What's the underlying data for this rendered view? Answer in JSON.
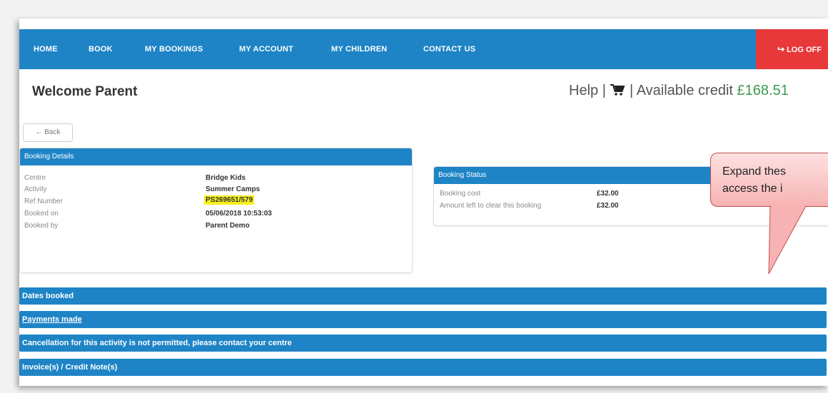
{
  "nav": {
    "items": [
      "HOME",
      "BOOK",
      "MY BOOKINGS",
      "MY ACCOUNT",
      "MY CHILDREN",
      "CONTACT US"
    ],
    "logoff": "LOG OFF"
  },
  "header": {
    "welcome": "Welcome Parent",
    "help": "Help",
    "separator": "|",
    "credit_label": "Available credit",
    "credit_value": "£168.51"
  },
  "back_label": "← Back",
  "booking_details": {
    "title": "Booking Details",
    "rows": [
      {
        "label": "Centre",
        "value": "Bridge Kids"
      },
      {
        "label": "Activity",
        "value": "Summer Camps"
      },
      {
        "label": "Ref Number",
        "value": "PS269651/579"
      },
      {
        "label": "Booked on",
        "value": "05/06/2018 10:53:03"
      },
      {
        "label": "Booked by",
        "value": "Parent Demo"
      }
    ]
  },
  "booking_status": {
    "title": "Booking Status",
    "rows": [
      {
        "label": "Booking cost",
        "value": "£32.00"
      },
      {
        "label": "Amount left to clear this booking",
        "value": "£32.00"
      }
    ]
  },
  "sections": [
    "Dates booked",
    "Payments made",
    "Cancellation for this activity is not permitted, please contact your centre",
    "Invoice(s) / Credit Note(s)"
  ],
  "callout": {
    "line1": "Expand thes",
    "line2": "access the i"
  },
  "colors": {
    "nav_blue": "#1e84c6",
    "logoff_red": "#e8383a",
    "credit_green": "#3c9a4e",
    "highlight_yellow": "#f5ef1e"
  }
}
